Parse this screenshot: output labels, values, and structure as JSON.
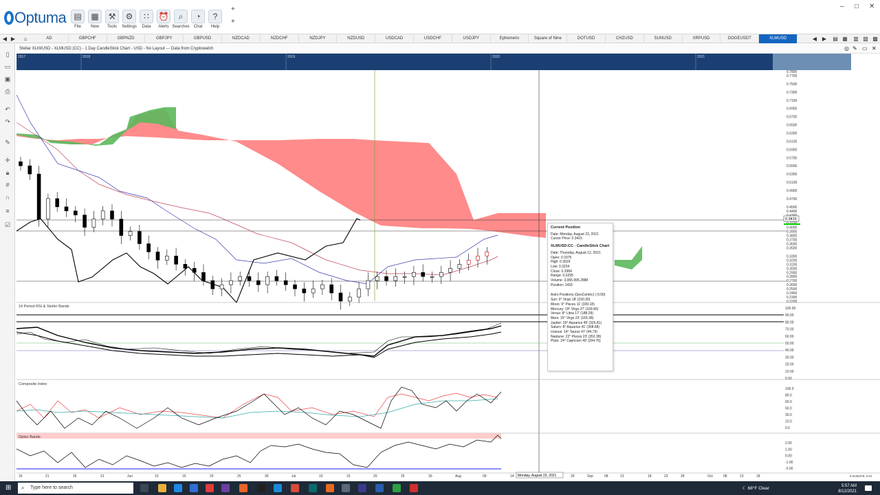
{
  "app": {
    "logo": "Optuma"
  },
  "toolbar": {
    "tools": [
      {
        "label": "File",
        "icon": "folder-icon",
        "glyph": "▤"
      },
      {
        "label": "New",
        "icon": "new-icon",
        "glyph": "▦"
      },
      {
        "label": "Tools",
        "icon": "tools-icon",
        "glyph": "⚒"
      },
      {
        "label": "Settings",
        "icon": "settings-icon",
        "glyph": "⚙"
      },
      {
        "label": "Data",
        "icon": "data-icon",
        "glyph": "∷"
      },
      {
        "label": "Alerts",
        "icon": "alerts-icon",
        "glyph": "⏰"
      },
      {
        "label": "Searches",
        "icon": "search-icon",
        "glyph": "⌕"
      },
      {
        "label": "Chat",
        "icon": "chat-icon",
        "glyph": "◔"
      },
      {
        "label": "Help",
        "icon": "help-icon",
        "glyph": "?"
      }
    ],
    "plus1": "+",
    "plus2": "+"
  },
  "window": {
    "minimize": "–",
    "restore": "□",
    "close": "✕"
  },
  "tabs": [
    "AD",
    "GBPCHF",
    "GBPNZD",
    "GBPJPY",
    "GBPUSD",
    "NZDCAD",
    "NZDCHF",
    "NZDJPY",
    "NZDUSD",
    "USDCAD",
    "USDCHF",
    "USDJPY",
    "Ephemeris",
    "Square of Nine",
    "DOTUSD",
    "CHZUSD",
    "SUNUSD",
    "XRPUSD",
    "DOGEUSDT",
    "XLMUSD"
  ],
  "active_tab": "XLMUSD",
  "chart_title": "Stellar XLM/USD - XLMUSD (CC) - 1 Day CandleStick Chart - USD - No Layout --- Data from Cryptowatch",
  "overview_years": [
    "2017",
    "2018",
    "2019",
    "2020",
    "2021"
  ],
  "price_axis": {
    "labels": [
      "0.7800",
      "0.7700",
      "0.7500",
      "0.7300",
      "0.7100",
      "0.6900",
      "0.6700",
      "0.6500",
      "0.6300",
      "0.6100",
      "0.5900",
      "0.5700",
      "0.5500",
      "0.5300",
      "0.5100",
      "0.4900",
      "0.4700",
      "0.4500",
      "0.4400",
      "0.4300",
      "0.4200",
      "0.4100",
      "0.4000",
      "0.3900",
      "0.3800",
      "0.3700",
      "0.3600",
      "0.3500",
      "0.3415",
      "0.3300",
      "0.3200",
      "0.3100",
      "0.3000",
      "0.2900",
      "0.2800",
      "0.2700",
      "0.2600",
      "0.2500",
      "0.2400",
      "0.2300",
      "0.2200"
    ],
    "current": "0.3415"
  },
  "panels": {
    "rsi": {
      "title": "14 Period RSI & Stoller Bands",
      "labels": [
        "100.00",
        "90.00",
        "80.00",
        "70.00",
        "60.00",
        "50.00",
        "40.00",
        "30.00",
        "20.00",
        "10.00",
        "0.00"
      ]
    },
    "composite": {
      "title": "Composite Index",
      "labels": [
        "100.0",
        "80.0",
        "60.0",
        "50.0",
        "30.0",
        "10.0",
        "0.0"
      ]
    },
    "optex": {
      "title": "Optex Bands",
      "labels": [
        "2.00",
        "1.00",
        "0.00",
        "-1.00",
        "-2.00"
      ]
    }
  },
  "date_axis": {
    "labels": [
      "16",
      "21",
      "26",
      "31",
      "Jun",
      "10",
      "15",
      "20",
      "25",
      "30",
      "Jul",
      "10",
      "15",
      "20",
      "25",
      "30",
      "Aug",
      "09",
      "14",
      "29",
      "Sep",
      "08",
      "13",
      "18",
      "23",
      "28",
      "Oct",
      "08",
      "13",
      "18"
    ],
    "cursor_date": "Monday, August 23, 2021",
    "corner": "0.0135376; 0.01"
  },
  "tooltip": {
    "header": "Current Position",
    "date": "Date: Monday, August 23, 2021",
    "cursor_price": "Cursor Price: 0.3415",
    "section": "XLMUSD:CC - CandleStick Chart",
    "bar_date": "Date: Thursday, August 12, 2021",
    "open": "Open: 0.3375",
    "high": "High: 0.3529",
    "low": "Low: 0.3234",
    "close": "Close: 0.3384",
    "range": "Range: 0.0295",
    "volume": "Volume: 3,065,995.2888",
    "position": "Position: 1433",
    "astro_header": "Astro Positions (GeoCentric) (-5:00)",
    "astro": [
      "Sun: 0° Virgo 18' (150.30)",
      "Moon: 9° Pisces 11' (339.18)",
      "Mercury: 19° Virgo 27' (169.45)",
      "Venus: 8° Libra 17' (188.28)",
      "Mars: 15° Virgo 23' (165.38)",
      "Jupiter: 26° Aquarius 49' (326.81)",
      "Saturn: 8° Aquarius 41' (308.68)",
      "Uranus: 14° Taurus 47' (44.79)",
      "Neptune: 22° Pisces 23' (352.38)",
      "Pluto: 24° Capricorn 49' (294.76)"
    ]
  },
  "chart_data": {
    "type": "candlestick",
    "title": "Stellar XLM/USD - XLMUSD (CC) - 1 Day CandleStick Chart - USD - No Layout --- Data from Cryptowatch",
    "period": "1 Day",
    "ylim": [
      0.22,
      0.78
    ],
    "current_price": 0.3415,
    "highlighted_bar": {
      "date": "Thursday, August 12, 2021",
      "open": 0.3375,
      "high": 0.3529,
      "low": 0.3234,
      "close": 0.3384,
      "range": 0.0295,
      "volume": 3065995.2888,
      "position": 1433
    },
    "candles_close": [
      0.55,
      0.53,
      0.42,
      0.47,
      0.45,
      0.44,
      0.43,
      0.4,
      0.42,
      0.44,
      0.42,
      0.38,
      0.39,
      0.36,
      0.34,
      0.32,
      0.33,
      0.31,
      0.3,
      0.29,
      0.27,
      0.25,
      0.26,
      0.27,
      0.28,
      0.27,
      0.26,
      0.28,
      0.27,
      0.26,
      0.25,
      0.24,
      0.25,
      0.26,
      0.24,
      0.22,
      0.23,
      0.25,
      0.27,
      0.28,
      0.27,
      0.28,
      0.28,
      0.29,
      0.28,
      0.28,
      0.29,
      0.3,
      0.31,
      0.32,
      0.33,
      0.34
    ]
  },
  "taskbar": {
    "search_placeholder": "Type here to search",
    "weather": "68°F  Clear",
    "time": "5:57 AM",
    "date": "8/12/2021"
  }
}
